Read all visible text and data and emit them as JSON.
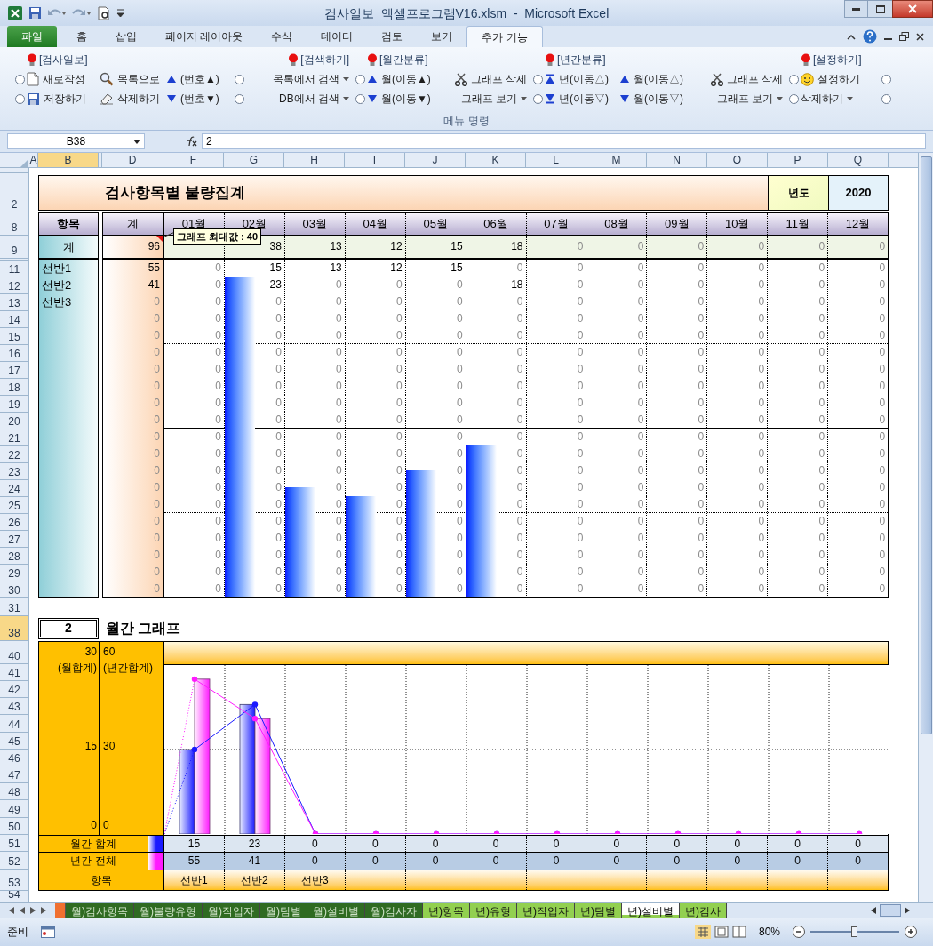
{
  "window": {
    "title": "검사일보_엑셀프로그램V16.xlsm  -  Microsoft Excel"
  },
  "ribbon": {
    "tabs": [
      {
        "label": "파일",
        "kind": "file",
        "selected": false
      },
      {
        "label": "홈",
        "kind": "tab",
        "selected": false
      },
      {
        "label": "삽입",
        "kind": "tab",
        "selected": false
      },
      {
        "label": "페이지 레이아웃",
        "kind": "tab",
        "selected": false
      },
      {
        "label": "수식",
        "kind": "tab",
        "selected": false
      },
      {
        "label": "데이터",
        "kind": "tab",
        "selected": false
      },
      {
        "label": "검토",
        "kind": "tab",
        "selected": false
      },
      {
        "label": "보기",
        "kind": "tab",
        "selected": false
      },
      {
        "label": "추가 기능",
        "kind": "tab",
        "selected": true
      }
    ],
    "columns": [
      {
        "items": [
          {
            "kind": "radio",
            "selected": false
          },
          {
            "kind": "radio",
            "selected": false
          }
        ]
      },
      {
        "header": "[검사일보]",
        "items": [
          {
            "kind": "doc",
            "label": "새로작성"
          },
          {
            "kind": "save",
            "label": "저장하기"
          }
        ]
      },
      {
        "items": [
          {
            "kind": "find",
            "label": "목록으로"
          },
          {
            "kind": "erase",
            "label": "삭제하기"
          }
        ]
      },
      {
        "items": [
          {
            "kind": "up",
            "label": "(번호▲)"
          },
          {
            "kind": "down",
            "label": "(번호▼)"
          }
        ]
      },
      {
        "items": [
          {
            "kind": "radio",
            "selected": false
          },
          {
            "kind": "radio",
            "selected": false
          }
        ]
      },
      {
        "header": "[검색하기]",
        "items": [
          {
            "kind": "menu",
            "label": "목록에서 검색"
          },
          {
            "kind": "menu",
            "label": "DB에서 검색"
          }
        ]
      },
      {
        "items": [
          {
            "kind": "radio",
            "selected": false
          },
          {
            "kind": "radio",
            "selected": false
          }
        ]
      },
      {
        "header": "[월간분류]",
        "items": [
          {
            "kind": "up",
            "label": "월(이동▲)"
          },
          {
            "kind": "down",
            "label": "월(이동▼)"
          }
        ]
      },
      {
        "items": [
          {
            "kind": "cut",
            "label": "그래프 삭제"
          },
          {
            "kind": "menu",
            "label": "그래프 보기"
          }
        ]
      },
      {
        "items": [
          {
            "kind": "radio",
            "selected": false
          },
          {
            "kind": "radio",
            "selected": false
          }
        ]
      },
      {
        "header": "[년간분류]",
        "items": [
          {
            "kind": "top",
            "label": "년(이동△)"
          },
          {
            "kind": "bottom",
            "label": "년(이동▽)"
          }
        ]
      },
      {
        "items": [
          {
            "kind": "up",
            "label": "월(이동△)"
          },
          {
            "kind": "down",
            "label": "월(이동▽)"
          }
        ]
      },
      {
        "items": [
          {
            "kind": "cut",
            "label": "그래프 삭제"
          },
          {
            "kind": "menu",
            "label": "그래프 보기"
          }
        ]
      },
      {
        "items": [
          {
            "kind": "radio",
            "selected": false
          },
          {
            "kind": "radio",
            "selected": false
          }
        ]
      },
      {
        "header": "[설정하기]",
        "items": [
          {
            "kind": "smile",
            "label": "설정하기"
          },
          {
            "kind": "menu",
            "label": "삭제하기"
          }
        ]
      },
      {
        "items": [
          {
            "kind": "radio",
            "selected": false
          },
          {
            "kind": "radio",
            "selected": false
          }
        ]
      }
    ],
    "group_label": "메뉴 명령"
  },
  "formula_bar": {
    "name_box": "B38",
    "formula": "2"
  },
  "column_headers": [
    {
      "label": "A",
      "selected": false
    },
    {
      "label": "B",
      "selected": true
    },
    {
      "label": "D",
      "selected": false
    },
    {
      "label": "F",
      "selected": false
    },
    {
      "label": "G",
      "selected": false
    },
    {
      "label": "H",
      "selected": false
    },
    {
      "label": "I",
      "selected": false
    },
    {
      "label": "J",
      "selected": false
    },
    {
      "label": "K",
      "selected": false
    },
    {
      "label": "L",
      "selected": false
    },
    {
      "label": "M",
      "selected": false
    },
    {
      "label": "N",
      "selected": false
    },
    {
      "label": "O",
      "selected": false
    },
    {
      "label": "P",
      "selected": false
    },
    {
      "label": "Q",
      "selected": false
    }
  ],
  "row_headers": [
    {
      "label": "2",
      "selected": false
    },
    {
      "label": "8",
      "selected": false
    },
    {
      "label": "9",
      "selected": false
    },
    {
      "label": "11",
      "selected": false
    },
    {
      "label": "12",
      "selected": false
    },
    {
      "label": "13",
      "selected": false
    },
    {
      "label": "14",
      "selected": false
    },
    {
      "label": "15",
      "selected": false
    },
    {
      "label": "16",
      "selected": false
    },
    {
      "label": "17",
      "selected": false
    },
    {
      "label": "18",
      "selected": false
    },
    {
      "label": "19",
      "selected": false
    },
    {
      "label": "20",
      "selected": false
    },
    {
      "label": "21",
      "selected": false
    },
    {
      "label": "22",
      "selected": false
    },
    {
      "label": "23",
      "selected": false
    },
    {
      "label": "24",
      "selected": false
    },
    {
      "label": "25",
      "selected": false
    },
    {
      "label": "26",
      "selected": false
    },
    {
      "label": "27",
      "selected": false
    },
    {
      "label": "28",
      "selected": false
    },
    {
      "label": "29",
      "selected": false
    },
    {
      "label": "30",
      "selected": false
    },
    {
      "label": "31",
      "selected": false
    },
    {
      "label": "38",
      "selected": true
    },
    {
      "label": "40",
      "selected": false
    },
    {
      "label": "41",
      "selected": false
    },
    {
      "label": "42",
      "selected": false
    },
    {
      "label": "43",
      "selected": false
    },
    {
      "label": "44",
      "selected": false
    },
    {
      "label": "45",
      "selected": false
    },
    {
      "label": "46",
      "selected": false
    },
    {
      "label": "47",
      "selected": false
    },
    {
      "label": "48",
      "selected": false
    },
    {
      "label": "49",
      "selected": false
    },
    {
      "label": "50",
      "selected": false
    },
    {
      "label": "51",
      "selected": false
    },
    {
      "label": "52",
      "selected": false
    },
    {
      "label": "53",
      "selected": false
    },
    {
      "label": "54",
      "selected": false
    }
  ],
  "sheet": {
    "title": "검사항목별 불량집계",
    "year_label": "년도",
    "year": "2020",
    "item_header": "항목",
    "total_header": "계",
    "months": [
      "01월",
      "02월",
      "03월",
      "04월",
      "05월",
      "06월",
      "07월",
      "08월",
      "09월",
      "10월",
      "11월",
      "12월"
    ],
    "total_row": {
      "label": "계",
      "total": "96",
      "months": [
        "38",
        "13",
        "12",
        "15",
        "18",
        "0",
        "0",
        "0",
        "0",
        "0",
        "0"
      ]
    },
    "comment": {
      "label": "그래프 최대값 :",
      "value": "40"
    },
    "rows": [
      {
        "label": "선반1",
        "total": "55",
        "months": [
          "0",
          "15",
          "13",
          "12",
          "15",
          "0",
          "0",
          "0",
          "0",
          "0",
          "0",
          "0"
        ]
      },
      {
        "label": "선반2",
        "total": "41",
        "months": [
          "0",
          "23",
          "0",
          "0",
          "0",
          "18",
          "0",
          "0",
          "0",
          "0",
          "0",
          "0"
        ]
      },
      {
        "label": "선반3",
        "total": "0",
        "months": [
          "0",
          "0",
          "0",
          "0",
          "0",
          "0",
          "0",
          "0",
          "0",
          "0",
          "0",
          "0"
        ]
      },
      {
        "total": "0",
        "months": [
          "0",
          "0",
          "0",
          "0",
          "0",
          "0",
          "0",
          "0",
          "0",
          "0",
          "0",
          "0"
        ]
      },
      {
        "total": "0",
        "months": [
          "0",
          "0",
          "0",
          "0",
          "0",
          "0",
          "0",
          "0",
          "0",
          "0",
          "0",
          "0"
        ]
      },
      {
        "total": "0",
        "months": [
          "0",
          "0",
          "0",
          "0",
          "0",
          "0",
          "0",
          "0",
          "0",
          "0",
          "0",
          "0"
        ]
      },
      {
        "total": "0",
        "months": [
          "0",
          "0",
          "0",
          "0",
          "0",
          "0",
          "0",
          "0",
          "0",
          "0",
          "0",
          "0"
        ]
      },
      {
        "total": "0",
        "months": [
          "0",
          "0",
          "0",
          "0",
          "0",
          "0",
          "0",
          "0",
          "0",
          "0",
          "0",
          "0"
        ]
      },
      {
        "total": "0",
        "months": [
          "0",
          "0",
          "0",
          "0",
          "0",
          "0",
          "0",
          "0",
          "0",
          "0",
          "0",
          "0"
        ]
      },
      {
        "total": "0",
        "months": [
          "0",
          "0",
          "0",
          "0",
          "0",
          "0",
          "0",
          "0",
          "0",
          "0",
          "0",
          "0"
        ]
      },
      {
        "total": "0",
        "months": [
          "0",
          "0",
          "0",
          "0",
          "0",
          "0",
          "0",
          "0",
          "0",
          "0",
          "0",
          "0"
        ]
      },
      {
        "total": "0",
        "months": [
          "0",
          "0",
          "0",
          "0",
          "0",
          "0",
          "0",
          "0",
          "0",
          "0",
          "0",
          "0"
        ]
      },
      {
        "total": "0",
        "months": [
          "0",
          "0",
          "0",
          "0",
          "0",
          "0",
          "0",
          "0",
          "0",
          "0",
          "0",
          "0"
        ]
      },
      {
        "total": "0",
        "months": [
          "0",
          "0",
          "0",
          "0",
          "0",
          "0",
          "0",
          "0",
          "0",
          "0",
          "0",
          "0"
        ]
      },
      {
        "total": "0",
        "months": [
          "0",
          "0",
          "0",
          "0",
          "0",
          "0",
          "0",
          "0",
          "0",
          "0",
          "0",
          "0"
        ]
      },
      {
        "total": "0",
        "months": [
          "0",
          "0",
          "0",
          "0",
          "0",
          "0",
          "0",
          "0",
          "0",
          "0",
          "0",
          "0"
        ]
      },
      {
        "total": "0",
        "months": [
          "0",
          "0",
          "0",
          "0",
          "0",
          "0",
          "0",
          "0",
          "0",
          "0",
          "0",
          "0"
        ]
      },
      {
        "total": "0",
        "months": [
          "0",
          "0",
          "0",
          "0",
          "0",
          "0",
          "0",
          "0",
          "0",
          "0",
          "0",
          "0"
        ]
      },
      {
        "total": "0",
        "months": [
          "0",
          "0",
          "0",
          "0",
          "0",
          "0",
          "0",
          "0",
          "0",
          "0",
          "0",
          "0"
        ]
      },
      {
        "total": "0",
        "months": [
          "0",
          "0",
          "0",
          "0",
          "0",
          "0",
          "0",
          "0",
          "0",
          "0",
          "0",
          "0"
        ]
      }
    ]
  },
  "graph": {
    "selector": "2",
    "title": "월간 그래프",
    "left_axis": {
      "ticks": [
        "30",
        "15",
        "0"
      ],
      "caption": "(월합계)"
    },
    "right_axis": {
      "ticks": [
        "60",
        "30",
        "0"
      ],
      "caption": "(년간합계)"
    },
    "series": [
      {
        "label": "월간 합계",
        "color": "#1a1aff",
        "values": [
          "15",
          "23",
          "0",
          "0",
          "0",
          "0",
          "0",
          "0",
          "0",
          "0",
          "0",
          "0"
        ]
      },
      {
        "label": "년간 전체",
        "color": "#ff1aff",
        "values": [
          "55",
          "41",
          "0",
          "0",
          "0",
          "0",
          "0",
          "0",
          "0",
          "0",
          "0",
          "0"
        ]
      }
    ],
    "category_label": "항목",
    "categories": [
      "선반1",
      "선반2",
      "선반3"
    ]
  },
  "sheet_tabs": [
    {
      "label": "월)검사항목",
      "color": "#2f6b22",
      "selected": false
    },
    {
      "label": "월)불량유형",
      "color": "#2f6b22",
      "selected": false
    },
    {
      "label": "월)작업자",
      "color": "#2f6b22",
      "selected": false
    },
    {
      "label": "월)팀별",
      "color": "#2f6b22",
      "selected": false
    },
    {
      "label": "월)설비별",
      "color": "#2f6b22",
      "selected": false
    },
    {
      "label": "월)검사자",
      "color": "#2f6b22",
      "selected": false
    },
    {
      "label": "년)항목",
      "color": "#92d050",
      "selected": false
    },
    {
      "label": "년)유형",
      "color": "#92d050",
      "selected": false
    },
    {
      "label": "년)작업자",
      "color": "#92d050",
      "selected": false
    },
    {
      "label": "년)팀별",
      "color": "#92d050",
      "selected": false
    },
    {
      "label": "년)설비별",
      "color": "#92d050",
      "selected": true
    },
    {
      "label": "년)검사",
      "color": "#92d050",
      "selected": false
    }
  ],
  "status_bar": {
    "status": "준비",
    "zoom": "80%",
    "zoom_slider": {
      "level": 0.5
    }
  }
}
